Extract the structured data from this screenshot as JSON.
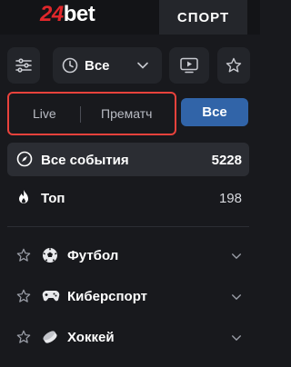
{
  "header": {
    "logo_number": "24",
    "logo_word": "bet",
    "active_tab": "СПОРТ"
  },
  "filters": {
    "period_value": "Все"
  },
  "mode": {
    "live_label": "Live",
    "prematch_label": "Прематч",
    "all_label": "Все"
  },
  "nav": {
    "all_events_label": "Все события",
    "all_events_count": "5228",
    "top_label": "Топ",
    "top_count": "198"
  },
  "sports": [
    {
      "label": "Футбол",
      "icon": "soccer-ball-icon"
    },
    {
      "label": "Киберспорт",
      "icon": "gamepad-icon"
    },
    {
      "label": "Хоккей",
      "icon": "hockey-puck-icon"
    }
  ],
  "colors": {
    "brand_red": "#e0272b",
    "accent_blue": "#3164a8",
    "highlight_border": "#e8423c",
    "background": "#18191d"
  }
}
